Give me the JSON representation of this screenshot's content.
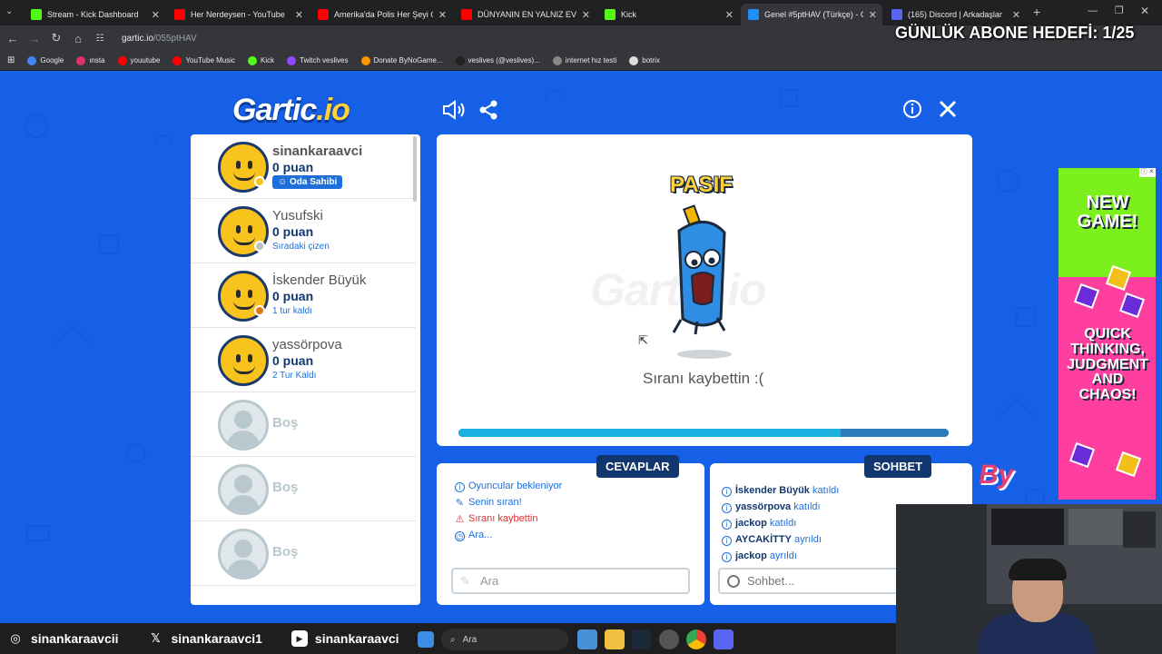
{
  "browser": {
    "tabs": [
      {
        "title": "Stream - Kick Dashboard",
        "color": "#53fc18"
      },
      {
        "title": "Her Nerdeysen - YouTube",
        "color": "#ff0000"
      },
      {
        "title": "Amerika'da Polis Her Şeyi Görü",
        "color": "#ff0000"
      },
      {
        "title": "DÜNYANIN EN YALNIZ EVİNDE",
        "color": "#ff0000"
      },
      {
        "title": "Kick",
        "color": "#53fc18"
      },
      {
        "title": "Genel #5ptHAV (Türkçe) - G",
        "color": "#1e90ff"
      },
      {
        "title": "(165) Discord | Arkadaşlar",
        "color": "#5865f2"
      }
    ],
    "url_host": "gartic.io",
    "url_path": "/055ptHAV",
    "bookmarks": [
      {
        "label": "Google",
        "color": "#4285f4"
      },
      {
        "label": "ınsta",
        "color": "#e1306c"
      },
      {
        "label": "youutube",
        "color": "#ff0000"
      },
      {
        "label": "YouTube Music",
        "color": "#ff0000"
      },
      {
        "label": "Kick",
        "color": "#53fc18"
      },
      {
        "label": "Twitch veslives",
        "color": "#9146ff"
      },
      {
        "label": "Donate ByNoGame...",
        "color": "#ff9800"
      },
      {
        "label": "veslives (@veslives)...",
        "color": "#222222"
      },
      {
        "label": "internet hız testi",
        "color": "#888888"
      },
      {
        "label": "botrix",
        "color": "#dddddd"
      }
    ]
  },
  "overlay": {
    "goal": "GÜNLÜK ABONE HEDEFİ: 1/25"
  },
  "game": {
    "logo_main": "Gartic",
    "logo_suffix": ".io",
    "players": [
      {
        "name": "sinankaraavci",
        "points": "0 puan",
        "badge": "Oda Sahibi",
        "dot": "#f9c31d"
      },
      {
        "name": "Yusufski",
        "points": "0 puan",
        "status": "Sıradaki çizen",
        "dot": "#c0c0c0"
      },
      {
        "name": "İskender Büyük",
        "points": "0 puan",
        "status": "1 tur kaldı",
        "dot": "#e07a12"
      },
      {
        "name": "yassörpova",
        "points": "0 puan",
        "status": "2 Tur Kaldı",
        "dot": ""
      }
    ],
    "empty_slot": "Boş",
    "canvas": {
      "watermark": "Gartic.io",
      "state_label": "PASIF",
      "message": "Sıranı kaybettin :(",
      "progress": 0.78
    },
    "answers": {
      "tab": "CEVAPLAR",
      "messages": [
        {
          "text": "Oyuncular bekleniyor",
          "type": "info"
        },
        {
          "text": "Senin sıran!",
          "type": "pencil"
        },
        {
          "text": "Sıranı kaybettin",
          "type": "warn"
        },
        {
          "text": "Ara...",
          "type": "clock"
        }
      ],
      "placeholder": "Ara"
    },
    "chat": {
      "tab": "SOHBET",
      "messages": [
        {
          "user": "İskender Büyük",
          "action": "katıldı"
        },
        {
          "user": "yassörpova",
          "action": "katıldı"
        },
        {
          "user": "jackop",
          "action": "katıldı"
        },
        {
          "user": "AYCAKİTTY",
          "action": "ayrıldı"
        },
        {
          "user": "jackop",
          "action": "ayrıldı"
        }
      ],
      "placeholder": "Sohbet..."
    }
  },
  "ad": {
    "line1": "NEW GAME!",
    "line2": "QUICK THINKING, JUDGMENT AND CHAOS!"
  },
  "stream_overlay": {
    "by": "By"
  },
  "social": [
    {
      "icon": "instagram-icon",
      "handle": "sinankaraavcii"
    },
    {
      "icon": "x-icon",
      "handle": "sinankaraavci1"
    },
    {
      "icon": "youtube-icon",
      "handle": "sinankaraavci"
    }
  ],
  "taskbar": {
    "search": "Ara"
  }
}
